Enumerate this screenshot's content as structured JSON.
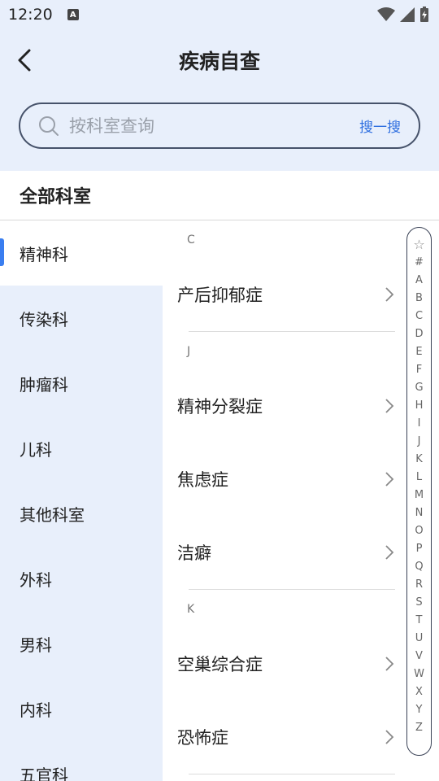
{
  "status": {
    "time": "12:20",
    "badge": "A"
  },
  "header": {
    "title": "疾病自查"
  },
  "search": {
    "placeholder": "按科室查询",
    "button": "搜一搜"
  },
  "section_title": "全部科室",
  "sidebar": {
    "items": [
      {
        "label": "精神科",
        "active": true
      },
      {
        "label": "传染科"
      },
      {
        "label": "肿瘤科"
      },
      {
        "label": "儿科"
      },
      {
        "label": "其他科室"
      },
      {
        "label": "外科"
      },
      {
        "label": "男科"
      },
      {
        "label": "内科"
      },
      {
        "label": "五官科"
      }
    ]
  },
  "groups": [
    {
      "letter": "C",
      "items": [
        "产后抑郁症"
      ]
    },
    {
      "letter": "J",
      "items": [
        "精神分裂症",
        "焦虑症",
        "洁癖"
      ]
    },
    {
      "letter": "K",
      "items": [
        "空巢综合症",
        "恐怖症"
      ]
    }
  ],
  "alphabet": [
    "☆",
    "#",
    "A",
    "B",
    "C",
    "D",
    "E",
    "F",
    "G",
    "H",
    "I",
    "J",
    "K",
    "L",
    "M",
    "N",
    "O",
    "P",
    "Q",
    "R",
    "S",
    "T",
    "U",
    "V",
    "W",
    "X",
    "Y",
    "Z"
  ],
  "colors": {
    "accent": "#2f6fe0",
    "background": "#e8effb",
    "active_indicator": "#3a7ef0"
  }
}
